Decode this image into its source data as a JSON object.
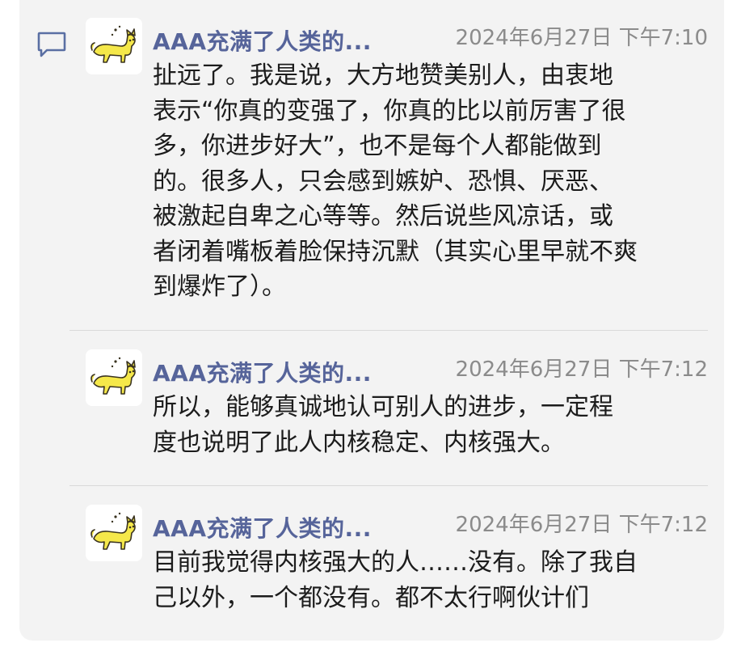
{
  "colors": {
    "card_background": "#f3f3f3",
    "sender_name": "#56649a",
    "timestamp": "#8b8b8b",
    "message_text": "#1c1c1c",
    "icon": "#5a6fa3",
    "avatar_cat": "#f5e84a"
  },
  "icons": {
    "comment": "comment-icon",
    "avatar": "yellow-cat-avatar"
  },
  "messages": [
    {
      "sender": "AAA充满了人类的...",
      "time": "2024年6月27日 下午7:10",
      "text": "扯远了。我是说，大方地赞美别人，由衷地\n表示“你真的变强了，你真的比以前厉害了很\n多，你进步好大”，也不是每个人都能做到\n的。很多人，只会感到嫉妒、恐惧、厌恶、\n被激起自卑之心等等。然后说些风凉话，或\n者闭着嘴板着脸保持沉默（其实心里早就不爽\n到爆炸了）。"
    },
    {
      "sender": "AAA充满了人类的...",
      "time": "2024年6月27日 下午7:12",
      "text": "所以，能够真诚地认可别人的进步，一定程\n度也说明了此人内核稳定、内核强大。"
    },
    {
      "sender": "AAA充满了人类的...",
      "time": "2024年6月27日 下午7:12",
      "text": "目前我觉得内核强大的人……没有。除了我自\n己以外，一个都没有。都不太行啊伙计们"
    }
  ]
}
